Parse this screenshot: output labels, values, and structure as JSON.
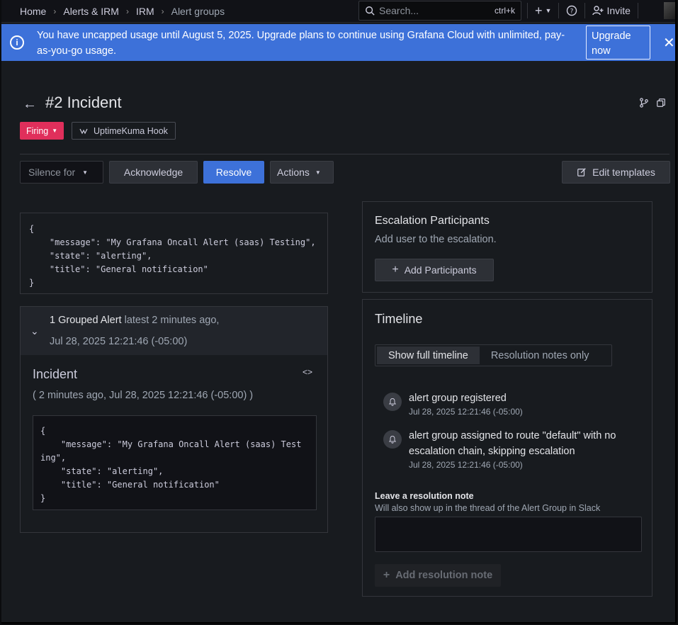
{
  "breadcrumb": [
    "Home",
    "Alerts & IRM",
    "IRM",
    "Alert groups"
  ],
  "search": {
    "placeholder": "Search...",
    "shortcut": "ctrl+k"
  },
  "nav": {
    "invite_label": "Invite"
  },
  "banner": {
    "message": "You have uncapped usage until August 5, 2025. Upgrade plans to continue using Grafana Cloud with unlimited, pay-as-you-go usage.",
    "upgrade_label": "Upgrade now"
  },
  "alert_group": {
    "title": "#2 Incident",
    "status": "Firing",
    "integration": "UptimeKuma Hook"
  },
  "toolbar": {
    "silence_label": "Silence for",
    "acknowledge_label": "Acknowledge",
    "resolve_label": "Resolve",
    "actions_label": "Actions",
    "edit_templates_label": "Edit templates"
  },
  "payload": "{\n    \"message\": \"My Grafana Oncall Alert (saas) Testing\",\n    \"state\": \"alerting\",\n    \"title\": \"General notification\"\n}",
  "grouped": {
    "count_label": "1 Grouped Alert",
    "latest_label": "latest 2 minutes ago,",
    "date": "Jul 28, 2025 12:21:46 (-05:00)",
    "incident_title": "Incident",
    "incident_time": "( 2 minutes ago, Jul 28, 2025 12:21:46 (-05:00) )",
    "payload": "{\n    \"message\": \"My Grafana Oncall Alert (saas) Test\ning\",\n    \"state\": \"alerting\",\n    \"title\": \"General notification\"\n}"
  },
  "escalation": {
    "heading": "Escalation Participants",
    "subtitle": "Add user to the escalation.",
    "add_label": "Add Participants"
  },
  "timeline": {
    "heading": "Timeline",
    "tabs": [
      "Show full timeline",
      "Resolution notes only"
    ],
    "events": [
      {
        "text": "alert group registered",
        "time": "Jul 28, 2025 12:21:46 (-05:00)"
      },
      {
        "text": "alert group assigned to route \"default\" with no escalation chain, skipping escalation",
        "time": "Jul 28, 2025 12:21:46 (-05:00)"
      }
    ],
    "note_label": "Leave a resolution note",
    "note_sub": "Will also show up in the thread of the Alert Group in Slack",
    "add_note_label": "Add resolution note"
  },
  "colors": {
    "accent": "#3d71d9",
    "firing": "#e02f5b",
    "background": "#181b1f"
  }
}
